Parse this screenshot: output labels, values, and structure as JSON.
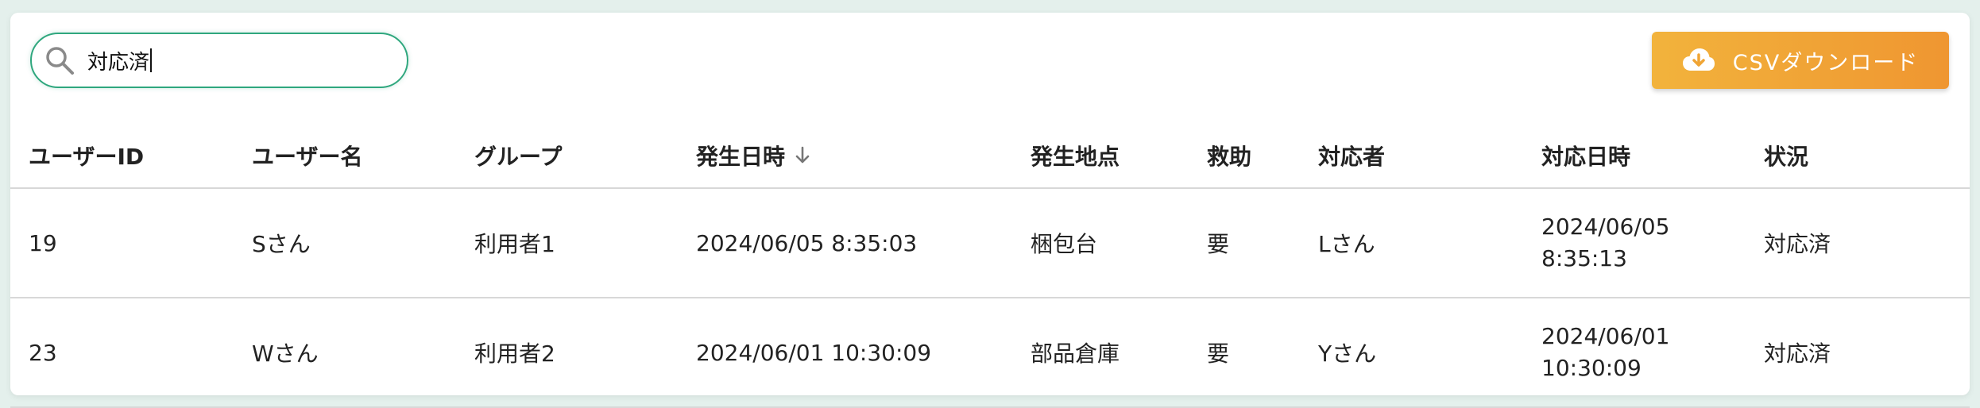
{
  "search": {
    "value": "対応済",
    "icon": "search-icon"
  },
  "toolbar": {
    "csv_label": "CSVダウンロード",
    "csv_icon": "cloud-download-icon",
    "accent": "#f0a535"
  },
  "table": {
    "headers": [
      "ユーザーID",
      "ユーザー名",
      "グループ",
      "発生日時",
      "発生地点",
      "救助",
      "対応者",
      "対応日時",
      "状況"
    ],
    "sort_column": "発生日時",
    "sort_direction": "descending",
    "rows": [
      {
        "user_id": "19",
        "user_name": "Sさん",
        "group": "利用者1",
        "occurred_at": "2024/06/05 8:35:03",
        "location": "梱包台",
        "rescue": "要",
        "responder": "Lさん",
        "responded_date": "2024/06/05",
        "responded_time": "8:35:13",
        "status": "対応済"
      },
      {
        "user_id": "23",
        "user_name": "Wさん",
        "group": "利用者2",
        "occurred_at": "2024/06/01 10:30:09",
        "location": "部品倉庫",
        "rescue": "要",
        "responder": "Yさん",
        "responded_date": "2024/06/01",
        "responded_time": "10:30:09",
        "status": "対応済"
      }
    ]
  },
  "colors": {
    "search_border": "#2fa77e",
    "background": "#e4f0ec",
    "button_gradient_start": "#f2b33c",
    "button_gradient_end": "#ef9631"
  }
}
